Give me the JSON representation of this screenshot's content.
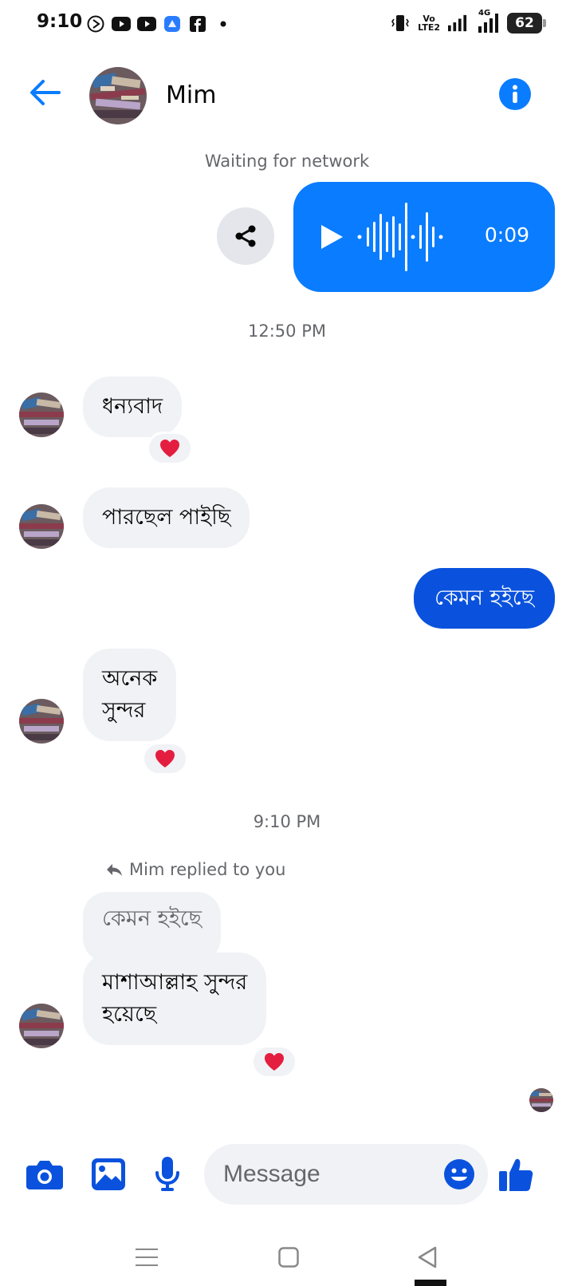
{
  "status_bar": {
    "time": "9:10",
    "battery": "62",
    "volte": "Vo",
    "lte": "LTE2",
    "network": "4G"
  },
  "header": {
    "contact_name": "Mim"
  },
  "network_status": "Waiting for network",
  "voice_message": {
    "duration": "0:09"
  },
  "timestamps": {
    "first": "12:50 PM",
    "second": "9:10 PM"
  },
  "messages": [
    {
      "direction": "incoming",
      "text": "ধন্যবাদ",
      "reaction": "heart"
    },
    {
      "direction": "incoming",
      "text": "পারছেল পাইছি",
      "reaction": ""
    },
    {
      "direction": "outgoing",
      "text": "কেমন হইছে",
      "reaction": ""
    },
    {
      "direction": "incoming",
      "text": "অনেক\nসুন্দর",
      "reaction": "heart"
    },
    {
      "direction": "incoming",
      "text": "মাশাআল্লাহ সুন্দর\nহয়েছে",
      "reaction": "heart",
      "reply_to": "কেমন হইছে"
    }
  ],
  "reply_label": "Mim replied to you",
  "composer": {
    "placeholder": "Message"
  },
  "colors": {
    "accent": "#0a7cff",
    "outgoing_bubble": "#0a52dd",
    "incoming_bubble": "#f0f2f5",
    "secondary_text": "#65676b",
    "heart": "#e41e3f"
  }
}
